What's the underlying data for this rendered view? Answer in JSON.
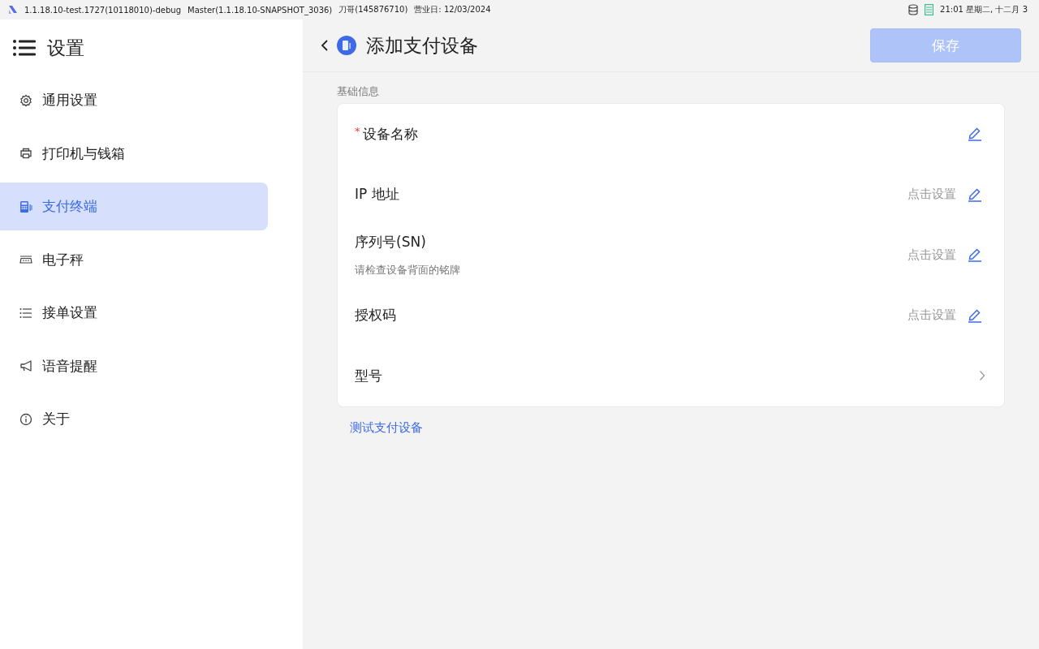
{
  "status_bar": {
    "app_info": "1.1.18.10-test.1727(10118010)-debug",
    "build": "Master(1.1.18.10-SNAPSHOT_3036)",
    "user": "刀哥(145876710)",
    "business_day": "营业日: 12/03/2024",
    "clock": "21:01 星期二, 十二月 3"
  },
  "sidebar": {
    "title": "设置",
    "items": [
      {
        "label": "通用设置",
        "selected": false
      },
      {
        "label": "打印机与钱箱",
        "selected": false
      },
      {
        "label": "支付终端",
        "selected": true
      },
      {
        "label": "电子秤",
        "selected": false
      },
      {
        "label": "接单设置",
        "selected": false
      },
      {
        "label": "语音提醒",
        "selected": false
      },
      {
        "label": "关于",
        "selected": false
      }
    ]
  },
  "header": {
    "title": "添加支付设备",
    "save_button": {
      "label": "保存",
      "disabled": true
    }
  },
  "section": {
    "title": "基础信息",
    "rows": [
      {
        "kind": "edit",
        "label": "设备名称",
        "required_mark": "*"
      },
      {
        "kind": "edit",
        "label": "IP 地址",
        "placeholder": "点击设置"
      },
      {
        "kind": "edit",
        "label": "序列号(SN)",
        "hint": "请检查设备背面的铭牌",
        "placeholder": "点击设置"
      },
      {
        "kind": "edit",
        "label": "授权码",
        "placeholder": "点击设置"
      },
      {
        "kind": "select",
        "label": "型号"
      }
    ]
  },
  "test_link": "测试支付设备"
}
